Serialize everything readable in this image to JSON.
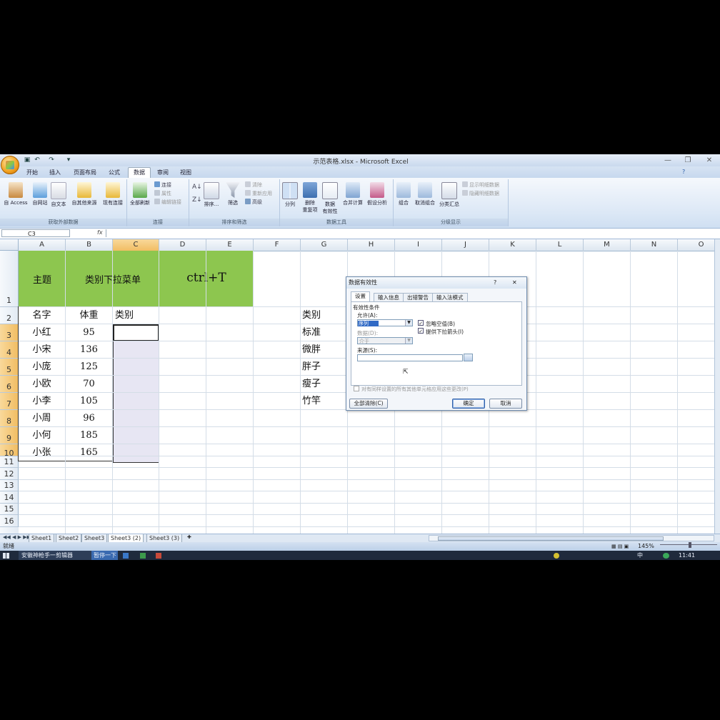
{
  "window": {
    "title": "示范表格.xlsx - Microsoft Excel",
    "qa_undo": "↶",
    "qa_redo": "↷",
    "qa_more": "▾",
    "controls": [
      "—",
      "❐",
      "✕"
    ],
    "help": "?"
  },
  "ribbon_tabs": [
    "开始",
    "插入",
    "页面布局",
    "公式",
    "数据",
    "审阅",
    "视图"
  ],
  "ribbon": {
    "get_external": {
      "label": "获取外部数据",
      "buttons": [
        "自 Access",
        "自网站",
        "自文本",
        "自其他来源",
        "现有连接"
      ]
    },
    "connections": {
      "label": "连接",
      "refresh_all": "全部刷新",
      "small": [
        "连接",
        "属性",
        "编辑链接"
      ]
    },
    "sort_filter": {
      "label": "排序和筛选",
      "sort": "排序...",
      "filter": "筛选",
      "small": [
        "清除",
        "重新应用",
        "高级"
      ]
    },
    "data_tools": {
      "label": "数据工具",
      "buttons": [
        "分列",
        "删除\n重复项",
        "数据\n有效性",
        "合并计算",
        "假设分析"
      ]
    },
    "outline": {
      "label": "分级显示",
      "buttons": [
        "组合",
        "取消组合",
        "分类汇总"
      ],
      "small": [
        "显示明细数据",
        "隐藏明细数据"
      ]
    }
  },
  "formula_bar": {
    "name_box": "C3",
    "fx": "fx",
    "content": ""
  },
  "columns": [
    "A",
    "B",
    "C",
    "D",
    "E",
    "F",
    "G",
    "H",
    "I",
    "J",
    "K",
    "L",
    "M",
    "N",
    "O"
  ],
  "rows": [
    "1",
    "2",
    "3",
    "4",
    "5",
    "6",
    "7",
    "8",
    "9",
    "10",
    "11",
    "12",
    "13",
    "14",
    "15",
    "16"
  ],
  "header_row": {
    "a": "主题",
    "bc": "类别下拉菜单",
    "de": "ctrl+T"
  },
  "table": {
    "headers": [
      "名字",
      "体重",
      "类别"
    ],
    "rows": [
      [
        "小红",
        "95",
        ""
      ],
      [
        "小宋",
        "136",
        ""
      ],
      [
        "小庞",
        "125",
        ""
      ],
      [
        "小欧",
        "70",
        ""
      ],
      [
        "小李",
        "105",
        ""
      ],
      [
        "小周",
        "96",
        ""
      ],
      [
        "小何",
        "185",
        ""
      ],
      [
        "小张",
        "165",
        ""
      ]
    ]
  },
  "category_list": [
    "类别",
    "标准",
    "微胖",
    "胖子",
    "瘦子",
    "竹竿"
  ],
  "dialog": {
    "title": "数据有效性",
    "help": "?",
    "close": "✕",
    "tabs": [
      "设置",
      "输入信息",
      "出错警告",
      "输入法模式"
    ],
    "section": "有效性条件",
    "allow_label": "允许(A):",
    "allow_value": "序列",
    "data_label": "数据(D):",
    "data_value": "介于",
    "ignore_blank": "忽略空值(B)",
    "dropdown": "提供下拉箭头(I)",
    "source_label": "来源(S):",
    "source_value": "",
    "apply_all": "对有同样设置的所有其他单元格应用这些更改(P)",
    "clear_all": "全部清除(C)",
    "ok": "确定",
    "cancel": "取消"
  },
  "sheet_tabs": [
    "Sheet1",
    "Sheet2",
    "Sheet3",
    "Sheet3 (2)",
    "Sheet3 (3)"
  ],
  "status": {
    "ready": "就绪",
    "zoom": "145%"
  },
  "taskbar": {
    "items": [
      "安徽神枪手一剪辑器",
      "暂停一下"
    ],
    "ime": "中",
    "time": "11:41"
  },
  "colors": {
    "header_green": "#8dc64f",
    "selection_fill": "#e7e6f3",
    "highlight_header": "#f1bd63"
  }
}
